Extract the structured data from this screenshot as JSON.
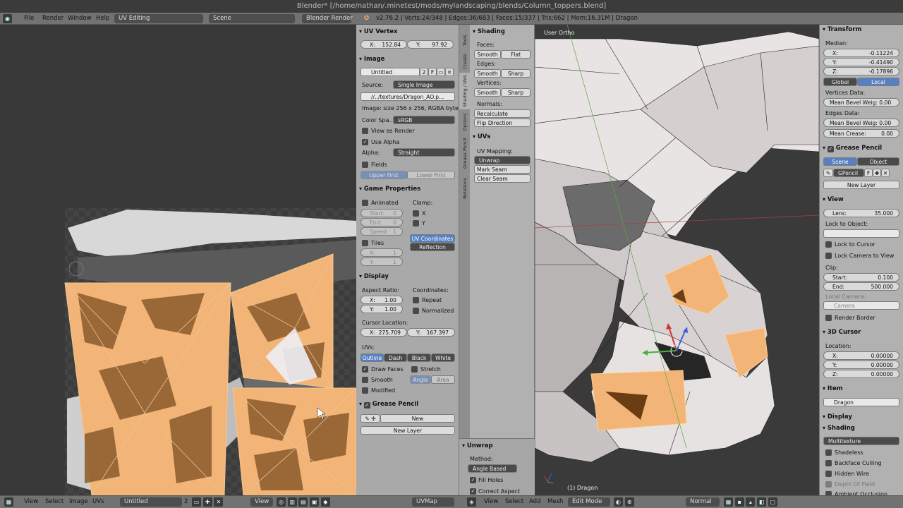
{
  "window": {
    "title": "Blender* [/home/nathan/.minetest/mods/mylandscaping/blends/Column_toppers.blend]"
  },
  "header": {
    "menus": [
      "File",
      "Render",
      "Window",
      "Help"
    ],
    "layout": "UV Editing",
    "scene": "Scene",
    "engine": "Blender Render",
    "stats": "v2.76.2 | Verts:24/348 | Edges:36/683 | Faces:15/337 | Tris:662 | Mem:16.31M | Dragon"
  },
  "uv_props": {
    "uv_vertex": {
      "title": "UV Vertex",
      "x_label": "X:",
      "x": "152.84",
      "y_label": "Y:",
      "y": "97.92"
    },
    "image": {
      "title": "Image",
      "name": "Untitled",
      "users": "2",
      "fake": "F",
      "source_label": "Source:",
      "source": "Single Image",
      "path": "//../textures/Dragon_AO.p...",
      "info": "Image: size 256 x 256, RGBA byte",
      "colorspace_label": "Color Spa...",
      "colorspace": "sRGB",
      "view_as_render": "View as Render",
      "use_alpha": "Use Alpha",
      "alpha_label": "Alpha:",
      "alpha": "Straight",
      "fields": "Fields",
      "upper_first": "Upper First",
      "lower_first": "Lower First"
    },
    "game": {
      "title": "Game Properties",
      "animated": "Animated",
      "clamp": "Clamp:",
      "start_l": "Start:",
      "start": "0",
      "end_l": "End:",
      "end": "0",
      "speed_l": "Speed:",
      "speed": "1",
      "cx": "X",
      "cy": "Y",
      "tiles": "Tiles",
      "tx_l": "X:",
      "tx": "1",
      "ty_l": "Y:",
      "ty": "1",
      "uv_coords": "UV Coordinates",
      "reflection": "Reflection"
    },
    "display": {
      "title": "Display",
      "aspect": "Aspect Ratio:",
      "coords": "Coordinates:",
      "ax_l": "X:",
      "ax": "1.00",
      "ay_l": "Y:",
      "ay": "1.00",
      "repeat": "Repeat",
      "normalized": "Normalized",
      "cursor_loc": "Cursor Location:",
      "cx_l": "X:",
      "cx": "275.709",
      "cy_l": "Y:",
      "cy": "167.397",
      "uvs": "UVs:",
      "uv_modes": [
        "Outline",
        "Dash",
        "Black",
        "White"
      ],
      "draw_faces": "Draw Faces",
      "stretch": "Stretch",
      "smooth": "Smooth",
      "angle": "Angle",
      "area": "Area",
      "modified": "Modified"
    },
    "grease": {
      "title": "Grease Pencil",
      "new": "New",
      "new_layer": "New Layer"
    }
  },
  "side_tabs": [
    "Tools",
    "Create",
    "Shading / UVs",
    "Options",
    "Grease Pencil",
    "Relations"
  ],
  "tools": {
    "shading": {
      "title": "Shading",
      "faces": "Faces:",
      "edges": "Edges:",
      "vertices": "Vertices:",
      "smooth": "Smooth",
      "flat": "Flat",
      "sharp": "Sharp",
      "normals": "Normals:",
      "recalc": "Recalculate",
      "flip": "Flip Direction"
    },
    "uvs": {
      "title": "UVs",
      "mapping": "UV Mapping:",
      "unwrap": "Unwrap",
      "mark": "Mark Seam",
      "clear": "Clear Seam"
    },
    "unwrap_op": {
      "title": "Unwrap",
      "method_l": "Method:",
      "method": "Angle Based",
      "fill": "Fill Holes",
      "correct": "Correct Aspect"
    }
  },
  "viewport": {
    "view_name": "User Ortho",
    "object_label": "(1) Dragon"
  },
  "n_panel": {
    "transform": {
      "title": "Transform",
      "median": "Median:",
      "x_l": "X:",
      "x": "-0.11224",
      "y_l": "Y:",
      "y": "-0.41490",
      "z_l": "Z:",
      "z": "-0.17896",
      "global": "Global",
      "local": "Local",
      "vdata": "Vertices Data:",
      "mean_bevel_v": "Mean Bevel Weig: 0.00",
      "edata": "Edges Data:",
      "mean_bevel_e": "Mean Bevel Weig: 0.00",
      "mean_crease": "Mean Crease:",
      "crease": "0.00"
    },
    "grease": {
      "title": "Grease Pencil",
      "scene": "Scene",
      "object": "Object",
      "gp_name": "GPencil",
      "gp_f": "F",
      "new_layer": "New Layer"
    },
    "view": {
      "title": "View",
      "lens_l": "Lens:",
      "lens": "35.000",
      "lock_obj": "Lock to Object:",
      "lock_cursor": "Lock to Cursor",
      "lock_cam": "Lock Camera to View",
      "clip": "Clip:",
      "start_l": "Start:",
      "start": "0.100",
      "end_l": "End:",
      "end": "500.000",
      "local_cam": "Local Camera:",
      "camera": "Camera",
      "render_border": "Render Border"
    },
    "cursor": {
      "title": "3D Cursor",
      "location": "Location:",
      "x_l": "X:",
      "x": "0.00000",
      "y_l": "Y:",
      "y": "0.00000",
      "z_l": "Z:",
      "z": "0.00000"
    },
    "item": {
      "title": "Item",
      "name": "Dragon"
    },
    "display": {
      "title": "Display"
    },
    "shading": {
      "title": "Shading",
      "mode": "Multitexture",
      "shadeless": "Shadeless",
      "backface": "Backface Culling",
      "hidden_wire": "Hidden Wire",
      "depth": "Depth Of Field",
      "ambient": "Ambient Occlusion"
    }
  },
  "bottom": {
    "img_menus": [
      "View",
      "Select",
      "Image",
      "UVs"
    ],
    "image_name": "Untitled",
    "users": "2",
    "view_mode": "View",
    "uvmap": "UVMap",
    "v3d_menus": [
      "View",
      "Select",
      "Add",
      "Mesh"
    ],
    "mode": "Edit Mode",
    "pivot": "Normal"
  },
  "colors": {
    "accent": "#5680c2",
    "panel": "#a9a9a9",
    "header": "#727272",
    "orange": "#f3b477"
  }
}
